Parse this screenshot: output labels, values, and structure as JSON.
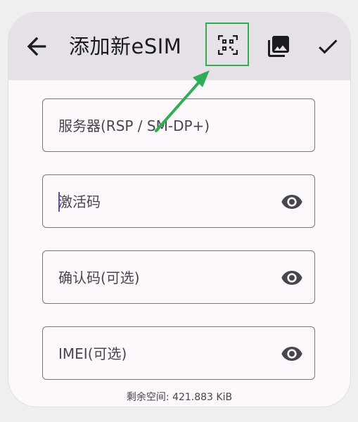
{
  "appbar": {
    "title": "添加新eSIM",
    "back_icon": "arrow-back-icon",
    "scan_icon": "qr-code-scanner-icon",
    "gallery_icon": "photo-library-icon",
    "confirm_icon": "check-icon"
  },
  "form": {
    "server_label": "服务器(RSP / SM-DP+)",
    "activation_label": "激活码",
    "confirmation_label": "确认码(可选)",
    "imei_label": "IMEI(可选)",
    "visibility_icon": "eye-icon"
  },
  "footer": {
    "free_space": "剩余空间: 421.883 KiB"
  },
  "annotation": {
    "highlight_color": "#2fae55"
  }
}
